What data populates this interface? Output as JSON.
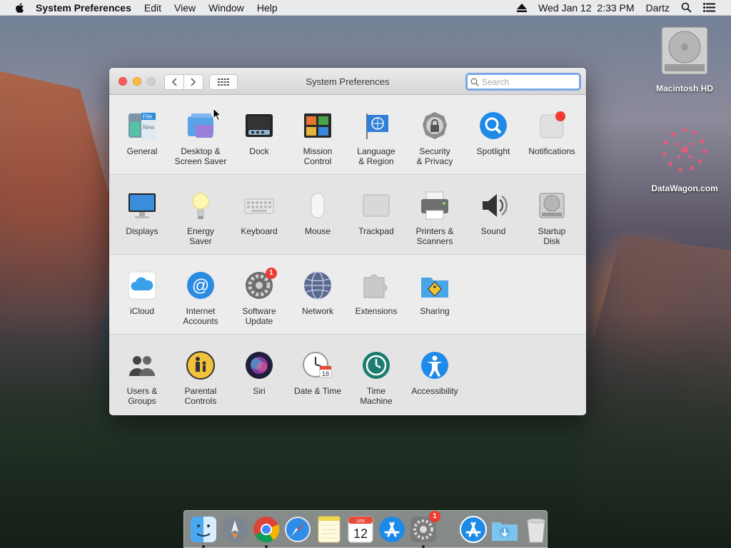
{
  "menubar": {
    "app_name": "System Preferences",
    "items": [
      "Edit",
      "View",
      "Window",
      "Help"
    ],
    "datetime": "Wed Jan 12  2:33 PM",
    "user": "Dartz"
  },
  "desktop": {
    "icons": [
      {
        "label": "Macintosh HD",
        "icon": "hard-drive-icon"
      },
      {
        "label": "DataWagon.com",
        "icon": "datawagon-logo-icon"
      }
    ]
  },
  "window": {
    "title": "System Preferences",
    "search_placeholder": "Search",
    "rows": [
      [
        {
          "label": "General",
          "icon": "general-icon"
        },
        {
          "label": "Desktop &\nScreen Saver",
          "icon": "desktop-screensaver-icon"
        },
        {
          "label": "Dock",
          "icon": "dock-icon"
        },
        {
          "label": "Mission\nControl",
          "icon": "mission-control-icon"
        },
        {
          "label": "Language\n& Region",
          "icon": "language-region-icon"
        },
        {
          "label": "Security\n& Privacy",
          "icon": "security-privacy-icon"
        },
        {
          "label": "Spotlight",
          "icon": "spotlight-icon"
        },
        {
          "label": "Notifications",
          "icon": "notifications-icon"
        }
      ],
      [
        {
          "label": "Displays",
          "icon": "displays-icon"
        },
        {
          "label": "Energy\nSaver",
          "icon": "energy-saver-icon"
        },
        {
          "label": "Keyboard",
          "icon": "keyboard-icon"
        },
        {
          "label": "Mouse",
          "icon": "mouse-icon"
        },
        {
          "label": "Trackpad",
          "icon": "trackpad-icon"
        },
        {
          "label": "Printers &\nScanners",
          "icon": "printers-scanners-icon"
        },
        {
          "label": "Sound",
          "icon": "sound-icon"
        },
        {
          "label": "Startup\nDisk",
          "icon": "startup-disk-icon"
        }
      ],
      [
        {
          "label": "iCloud",
          "icon": "icloud-icon"
        },
        {
          "label": "Internet\nAccounts",
          "icon": "internet-accounts-icon"
        },
        {
          "label": "Software\nUpdate",
          "icon": "software-update-icon",
          "badge": "1"
        },
        {
          "label": "Network",
          "icon": "network-icon"
        },
        {
          "label": "Extensions",
          "icon": "extensions-icon"
        },
        {
          "label": "Sharing",
          "icon": "sharing-icon"
        }
      ],
      [
        {
          "label": "Users &\nGroups",
          "icon": "users-groups-icon"
        },
        {
          "label": "Parental\nControls",
          "icon": "parental-controls-icon"
        },
        {
          "label": "Siri",
          "icon": "siri-icon"
        },
        {
          "label": "Date & Time",
          "icon": "date-time-icon"
        },
        {
          "label": "Time\nMachine",
          "icon": "time-machine-icon"
        },
        {
          "label": "Accessibility",
          "icon": "accessibility-icon"
        }
      ]
    ]
  },
  "dock": {
    "apps": [
      {
        "name": "finder",
        "running": true
      },
      {
        "name": "launchpad",
        "running": false
      },
      {
        "name": "chrome",
        "running": true
      },
      {
        "name": "safari",
        "running": false
      },
      {
        "name": "notes",
        "running": false
      },
      {
        "name": "calendar",
        "running": false,
        "day": "12",
        "month": "JAN"
      },
      {
        "name": "app-store",
        "running": false
      },
      {
        "name": "system-preferences",
        "running": true,
        "badge": "1"
      }
    ],
    "others": [
      {
        "name": "app-store-folder"
      },
      {
        "name": "downloads-folder"
      },
      {
        "name": "trash"
      }
    ]
  }
}
